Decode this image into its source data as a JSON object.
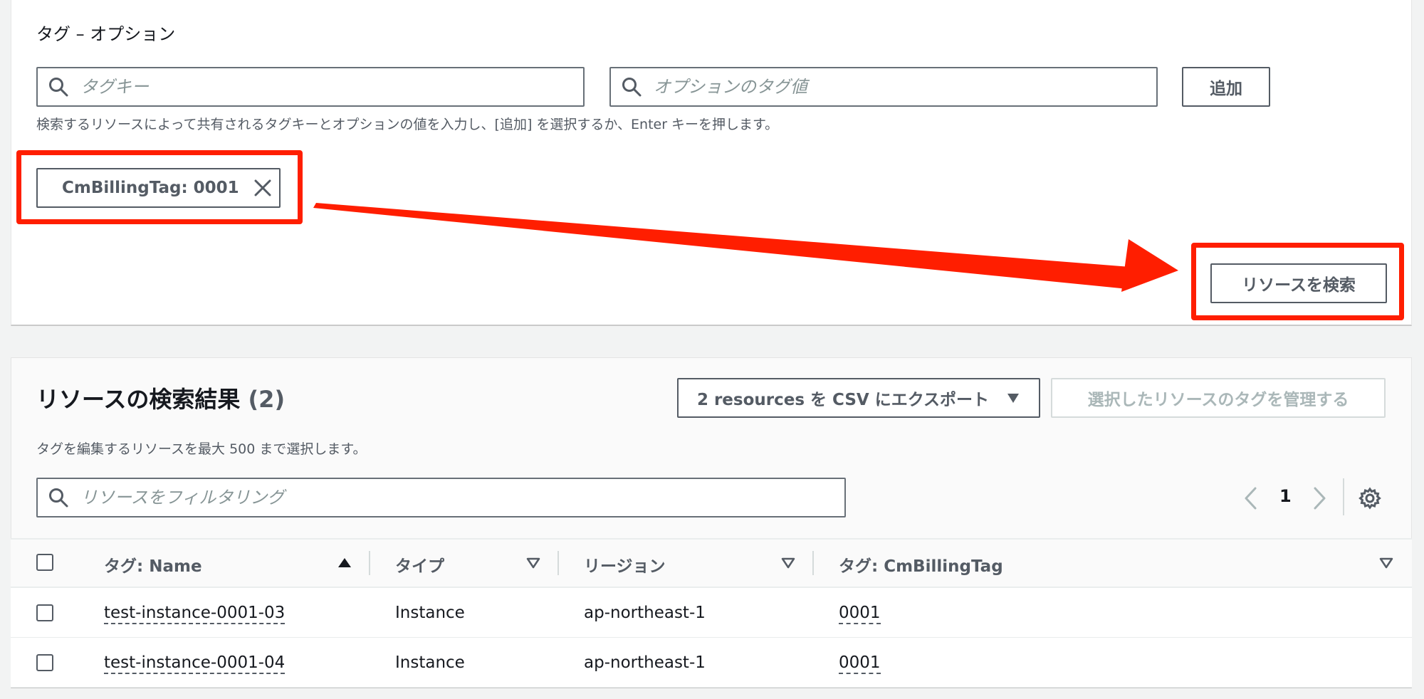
{
  "tags_section": {
    "title": "タグ – オプション",
    "tag_key_placeholder": "タグキー",
    "tag_value_placeholder": "オプションのタグ値",
    "add_button": "追加",
    "help_text": "検索するリソースによって共有されるタグキーとオプションの値を入力し、[追加] を選択するか、Enter キーを押します。",
    "token_label": "CmBillingTag: 0001",
    "search_button": "リソースを検索"
  },
  "results": {
    "title": "リソースの検索結果",
    "count": "(2)",
    "export_button": "2 resources を CSV にエクスポート",
    "manage_button": "選択したリソースのタグを管理する",
    "subtitle": "タグを編集するリソースを最大 500 まで選択します。",
    "filter_placeholder": "リソースをフィルタリング",
    "page": "1",
    "columns": [
      "タグ: Name",
      "タイプ",
      "リージョン",
      "タグ: CmBillingTag"
    ],
    "rows": [
      {
        "name": "test-instance-0001-03",
        "type": "Instance",
        "region": "ap-northeast-1",
        "tag": "0001"
      },
      {
        "name": "test-instance-0001-04",
        "type": "Instance",
        "region": "ap-northeast-1",
        "tag": "0001"
      }
    ]
  },
  "annotation_color": "#ff1e00",
  "icons": [
    "search-icon",
    "close-icon",
    "dropdown-triangle-icon",
    "chevron-left-icon",
    "chevron-right-icon",
    "gear-icon",
    "sort-ascending-icon",
    "sort-descending-icon"
  ]
}
